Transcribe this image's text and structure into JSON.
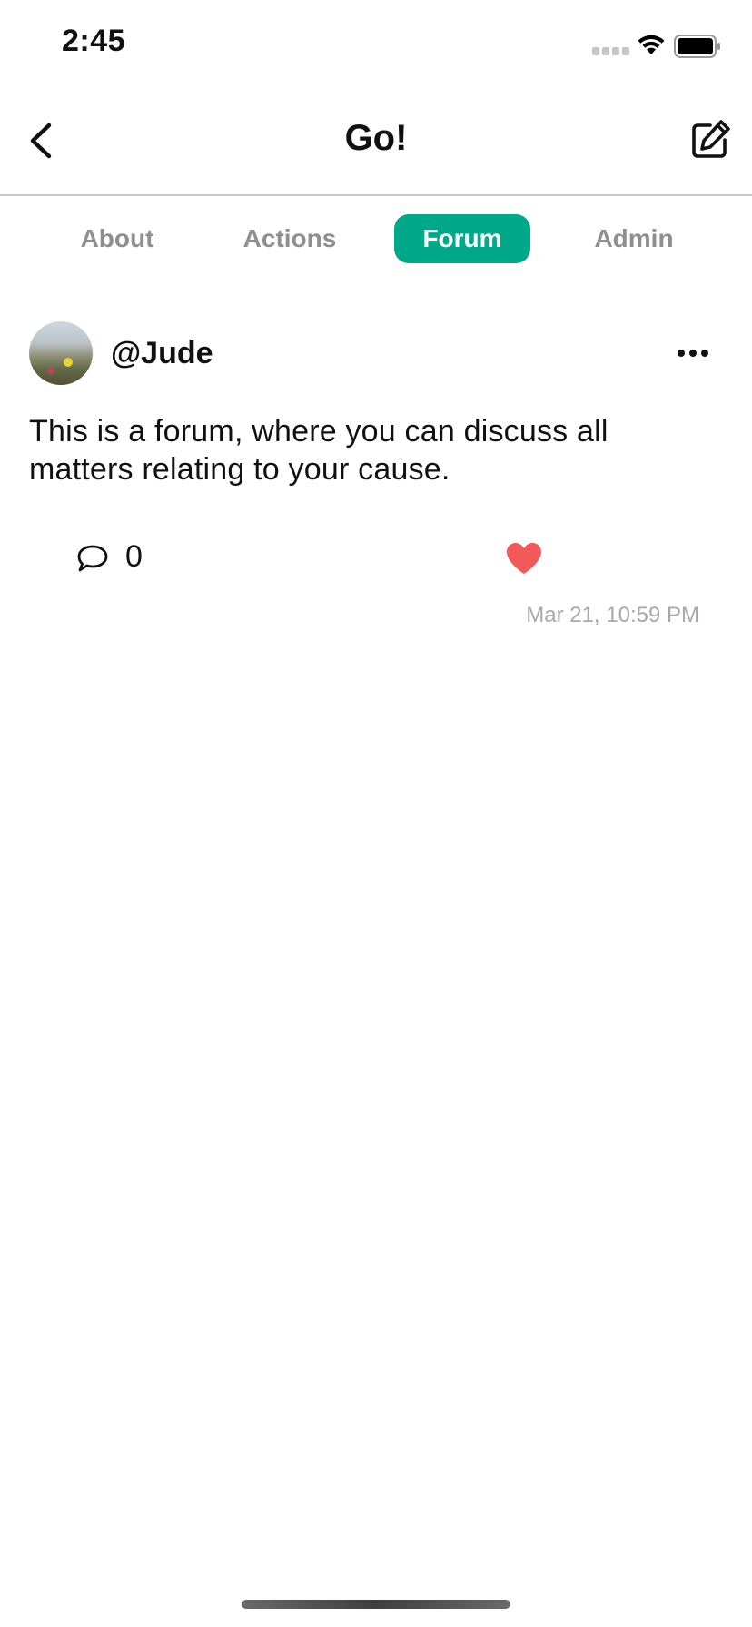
{
  "status_bar": {
    "time": "2:45"
  },
  "nav": {
    "title": "Go!",
    "back_icon": "chevron-left-icon",
    "edit_icon": "compose-icon"
  },
  "tabs": [
    {
      "label": "About",
      "active": false
    },
    {
      "label": "Actions",
      "active": false
    },
    {
      "label": "Forum",
      "active": true
    },
    {
      "label": "Admin",
      "active": false
    }
  ],
  "post": {
    "username": "@Jude",
    "body": "This is a forum, where you can discuss all matters relating to your cause.",
    "comment_count": "0",
    "timestamp": "Mar 21, 10:59 PM",
    "liked": true
  },
  "colors": {
    "accent": "#00a88a",
    "heart": "#f25a5a",
    "tab_inactive": "#8f8f8f",
    "timestamp": "#a8a8a8"
  }
}
